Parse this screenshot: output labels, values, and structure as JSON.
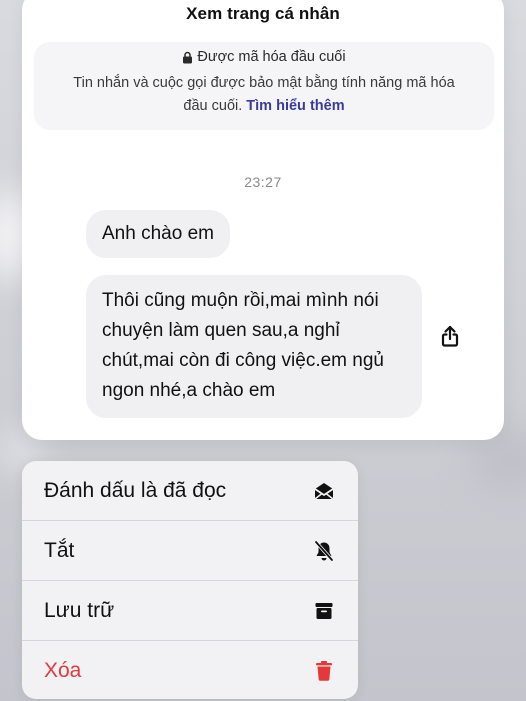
{
  "chat": {
    "profile_link": "Xem trang cá nhân",
    "encryption": {
      "title": "Được mã hóa đầu cuối",
      "description": "Tin nhắn và cuộc gọi được bảo mật bằng tính năng mã hóa đầu cuối.",
      "learn_more": "Tìm hiểu thêm"
    },
    "timestamp": "23:27",
    "messages": [
      {
        "text": "Anh chào em"
      },
      {
        "text": "Thôi cũng muộn rồi,mai mình nói chuyện làm quen sau,a nghỉ chút,mai còn đi công việc.em ngủ ngon nhé,a chào em"
      }
    ],
    "share_icon": "share-icon"
  },
  "menu": {
    "items": [
      {
        "label": "Đánh dấu là đã đọc",
        "icon": "envelope-open-icon"
      },
      {
        "label": "Tắt",
        "icon": "bell-slash-icon"
      },
      {
        "label": "Lưu trữ",
        "icon": "archive-icon"
      },
      {
        "label": "Xóa",
        "icon": "trash-icon",
        "color": "#e5383b"
      }
    ]
  }
}
